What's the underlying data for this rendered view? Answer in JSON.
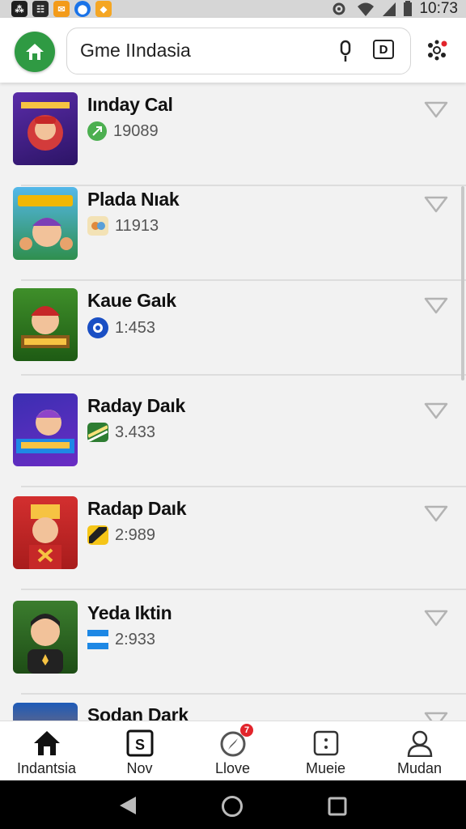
{
  "status_bar": {
    "time": "10:73",
    "left_icons": [
      {
        "label": "⁂",
        "color": "#1f1f1f"
      },
      {
        "label": "☷",
        "color": "#2a2a2a"
      },
      {
        "label": "✉",
        "color": "#f39b1a"
      },
      {
        "label": "⬤",
        "color": "#1a73e8"
      },
      {
        "label": "◆",
        "color": "#f5a623"
      }
    ]
  },
  "header": {
    "search_text": "Gme IIndasia",
    "d_button": "D"
  },
  "games": [
    {
      "title": "Iınday Cal",
      "count": "19089",
      "icon": "green-arrow-icon"
    },
    {
      "title": "Plada Nıak",
      "count": "11913",
      "icon": "mini-game-icon"
    },
    {
      "title": "Kaue Gaık",
      "count": "1:453",
      "icon": "blue-globe-icon"
    },
    {
      "title": "Raday Daık",
      "count": "3.433",
      "icon": "striped-badge-icon"
    },
    {
      "title": "Radap Daık",
      "count": "2:989",
      "icon": "yellow-badge-icon"
    },
    {
      "title": "Yeda Iktin",
      "count": "2:933",
      "icon": "flag-badge-icon"
    },
    {
      "title": "Sodan Dark",
      "count": "",
      "icon": ""
    }
  ],
  "nav": [
    {
      "label": "Indantsia",
      "icon": "home-icon"
    },
    {
      "label": "Nov",
      "icon": "s-box-icon"
    },
    {
      "label": "Llove",
      "icon": "compass-icon",
      "badge": "7"
    },
    {
      "label": "Mueie",
      "icon": "dotted-box-icon"
    },
    {
      "label": "Mudan",
      "icon": "person-icon"
    }
  ],
  "colors": {
    "accent_green": "#2f9a43",
    "badge_red": "#e2242b"
  }
}
